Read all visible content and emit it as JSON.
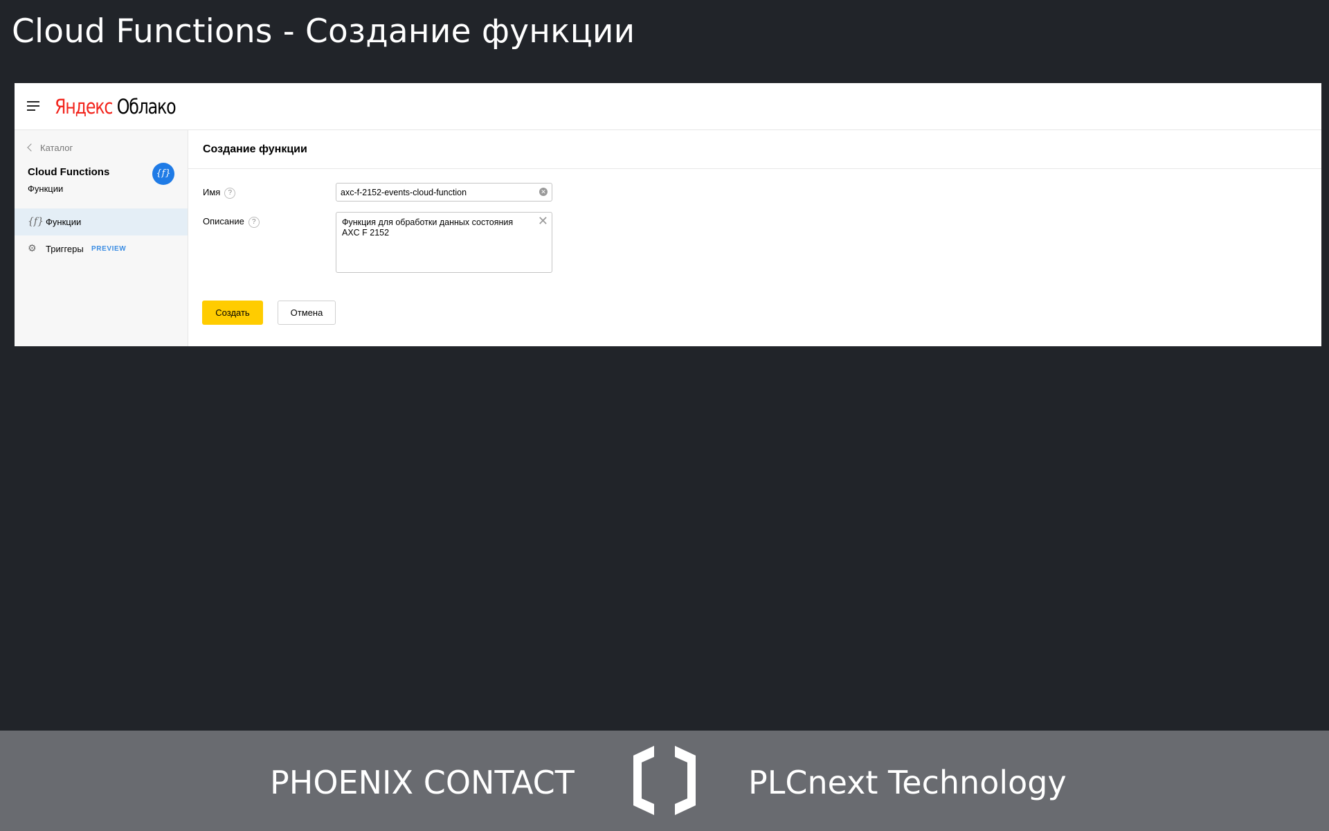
{
  "slide": {
    "title": "Cloud Functions - Создание функции"
  },
  "header": {
    "logo_brand": "Яндекс",
    "logo_product": "Облако"
  },
  "sidebar": {
    "back_label": "Каталог",
    "service_title": "Cloud Functions",
    "service_subtitle": "Функции",
    "service_icon": "{f}",
    "items": [
      {
        "label": "Функции",
        "icon": "{f}"
      },
      {
        "label": "Триггеры",
        "badge": "PREVIEW",
        "icon": "⚙"
      }
    ]
  },
  "main": {
    "title": "Создание функции",
    "fields": {
      "name": {
        "label": "Имя",
        "value": "axc-f-2152-events-cloud-function"
      },
      "description": {
        "label": "Описание",
        "value": "Функция для обработки данных состояния AXC F 2152"
      }
    },
    "help_glyph": "?",
    "buttons": {
      "create": "Создать",
      "cancel": "Отмена"
    }
  },
  "footer": {
    "brand": "PHOENIX CONTACT",
    "tech": "PLCnext Technology"
  },
  "colors": {
    "accent_yellow": "#ffcc00",
    "link_blue": "#1f7be6",
    "yandex_red": "#f2241c",
    "background": "#212429",
    "footer_bg": "#696b70"
  }
}
